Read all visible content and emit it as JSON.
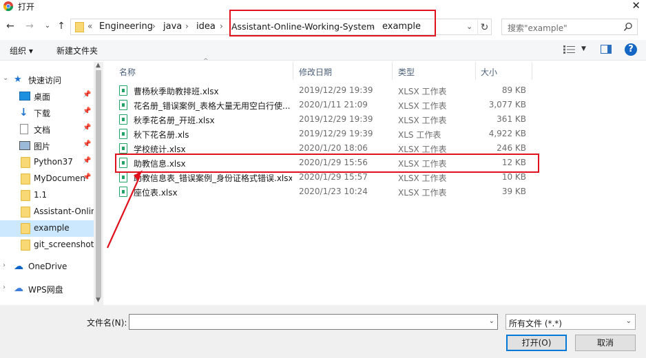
{
  "window": {
    "title": "打开",
    "close_glyph": "✕"
  },
  "nav": {
    "back": "←",
    "forward": "→",
    "recent": "⌄",
    "up": "↑"
  },
  "breadcrumb": {
    "overflow": "«",
    "items": [
      "Engineering",
      "java",
      "idea",
      "Assistant-Online-Working-System",
      "example"
    ],
    "separator": "›",
    "dropdown": "⌄",
    "refresh": "↻"
  },
  "search": {
    "placeholder": "搜索\"example\""
  },
  "toolbar": {
    "organize": "组织 ▾",
    "new_folder": "新建文件夹",
    "view_dropdown": "▼",
    "help": "?"
  },
  "sidebar": {
    "items": [
      {
        "label": "快速访问",
        "icon": "star-icon",
        "pinned": false
      },
      {
        "label": "桌面",
        "icon": "desktop-icon",
        "pinned": true
      },
      {
        "label": "下载",
        "icon": "download-icon",
        "pinned": true
      },
      {
        "label": "文档",
        "icon": "document-icon",
        "pinned": true
      },
      {
        "label": "图片",
        "icon": "picture-icon",
        "pinned": true
      },
      {
        "label": "Python37",
        "icon": "folder-icon",
        "pinned": true
      },
      {
        "label": "MyDocumen",
        "icon": "folder-icon",
        "pinned": true
      },
      {
        "label": "1.1",
        "icon": "folder-icon",
        "pinned": false
      },
      {
        "label": "Assistant-Onlin",
        "icon": "folder-icon",
        "pinned": false
      },
      {
        "label": "example",
        "icon": "folder-icon",
        "pinned": false,
        "selected": true
      },
      {
        "label": "git_screenshot",
        "icon": "folder-icon",
        "pinned": false
      },
      {
        "label": "OneDrive",
        "icon": "cloud-icon",
        "pinned": false
      },
      {
        "label": "WPS网盘",
        "icon": "wps-cloud-icon",
        "pinned": false
      }
    ]
  },
  "columns": {
    "name": "名称",
    "modified": "修改日期",
    "type": "类型",
    "size": "大小"
  },
  "files": [
    {
      "name": "曹杨秋季助教排班.xlsx",
      "modified": "2019/12/29 19:39",
      "type": "XLSX 工作表",
      "size": "89 KB"
    },
    {
      "name": "花名册_错误案例_表格大量无用空白行使...",
      "modified": "2020/1/11 21:09",
      "type": "XLSX 工作表",
      "size": "3,077 KB"
    },
    {
      "name": "秋季花名册_开班.xlsx",
      "modified": "2019/12/29 19:39",
      "type": "XLSX 工作表",
      "size": "361 KB"
    },
    {
      "name": "秋下花名册.xls",
      "modified": "2019/12/29 19:39",
      "type": "XLS 工作表",
      "size": "4,922 KB"
    },
    {
      "name": "学校统计.xlsx",
      "modified": "2020/1/20 18:06",
      "type": "XLSX 工作表",
      "size": "246 KB"
    },
    {
      "name": "助教信息.xlsx",
      "modified": "2020/1/29 15:56",
      "type": "XLSX 工作表",
      "size": "12 KB"
    },
    {
      "name": "助教信息表_错误案例_身份证格式错误.xlsx",
      "modified": "2020/1/29 15:57",
      "type": "XLSX 工作表",
      "size": "10 KB"
    },
    {
      "name": "座位表.xlsx",
      "modified": "2020/1/23 10:24",
      "type": "XLSX 工作表",
      "size": "39 KB"
    }
  ],
  "footer": {
    "filename_label": "文件名(N):",
    "filename_value": "",
    "filetype_value": "所有文件 (*.*)",
    "open_button": "打开(O)",
    "cancel_button": "取消"
  },
  "colors": {
    "annotation": "#e0101c",
    "selected": "#cce8ff",
    "accent": "#0078d7"
  }
}
